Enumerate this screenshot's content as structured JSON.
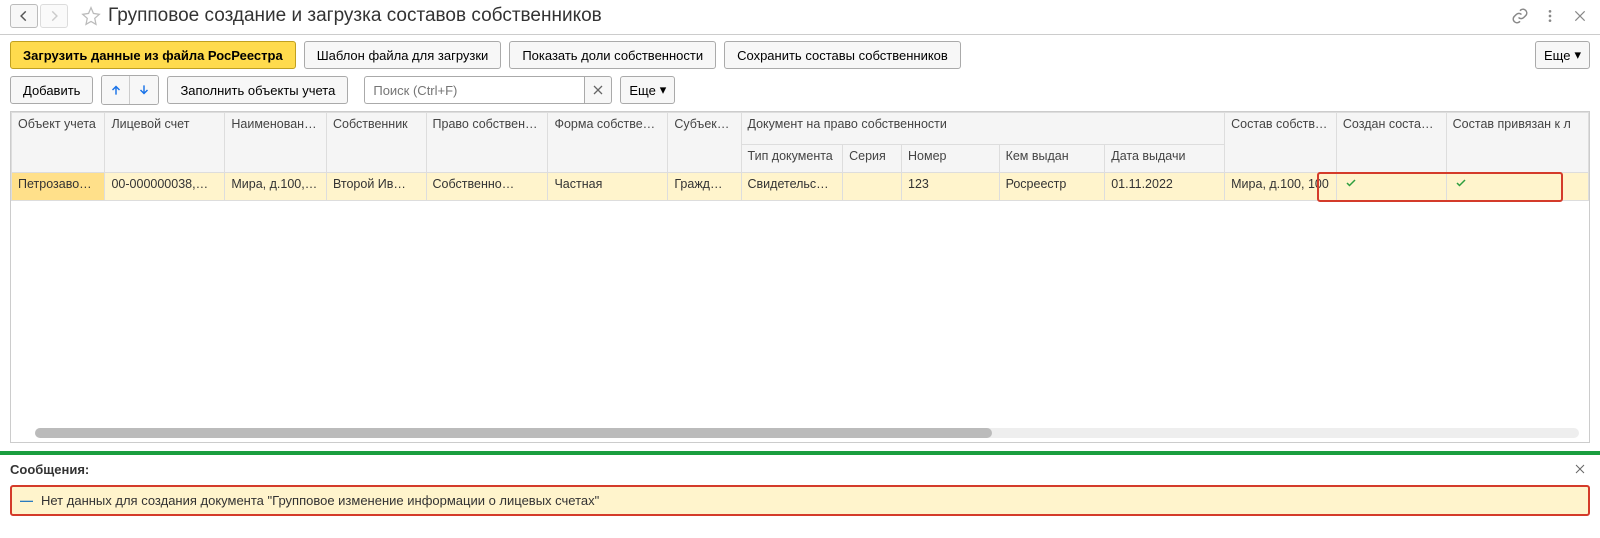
{
  "header": {
    "title": "Групповое создание и загрузка составов собственников"
  },
  "toolbar1": {
    "load_btn": "Загрузить данные из файла РосРеестра",
    "template_btn": "Шаблон файла для загрузки",
    "show_shares_btn": "Показать доли собственности",
    "save_comp_btn": "Сохранить составы собственников",
    "more_btn": "Еще"
  },
  "toolbar2": {
    "add_btn": "Добавить",
    "fill_btn": "Заполнить объекты учета",
    "search_placeholder": "Поиск (Ctrl+F)",
    "more_btn": "Еще"
  },
  "table": {
    "headers": {
      "object": "Объект учета",
      "account": "Лицевой счет",
      "comp_name": "Наименование состава",
      "owner": "Собственник",
      "right": "Право собственности",
      "form": "Форма собственности",
      "subject": "Субъект права",
      "doc_group": "Документ на право собственности",
      "doc_type": "Тип документа",
      "series": "Серия",
      "number": "Номер",
      "issued_by": "Кем выдан",
      "issue_date": "Дата выдачи",
      "composition": "Состав собственников",
      "created": "Создан состав собственников",
      "linked": "Состав привязан к л"
    },
    "row": {
      "object": "Петрозаво…",
      "account": "00-000000038,…",
      "comp_name": "Мира, д.100,…",
      "owner": "Второй Ив…",
      "right": "Собственно…",
      "form": "Частная",
      "subject": "Гражд…",
      "doc_type": "Свидетельс…",
      "series": "",
      "number": "123",
      "issued_by": "Росреестр",
      "issue_date": "01.11.2022",
      "composition": "Мира, д.100, 100"
    }
  },
  "messages": {
    "title": "Сообщения:",
    "text": "Нет данных для создания документа \"Групповое изменение информации о лицевых счетах\""
  }
}
